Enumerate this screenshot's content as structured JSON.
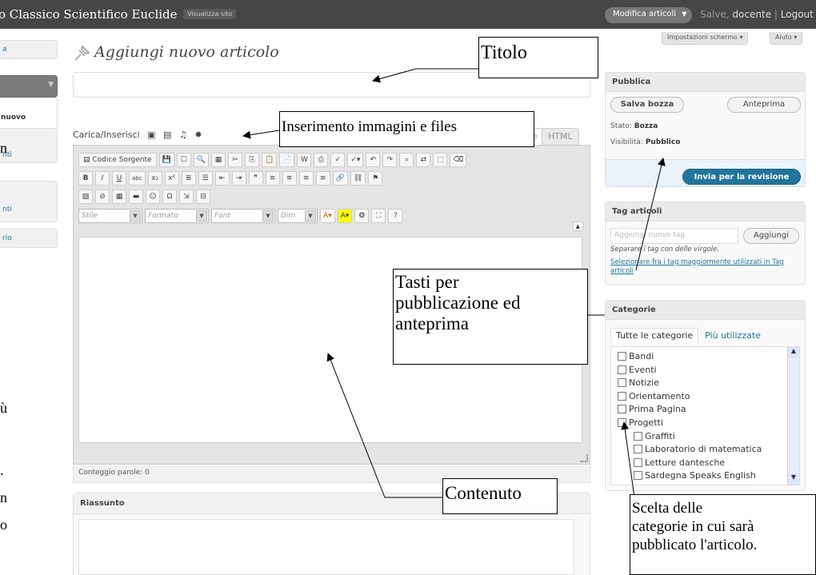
{
  "adminbar": {
    "site_name": "o Classico Scientifico Euclide",
    "visit_site": "Visualizza sito",
    "favorite_action": "Modifica articoli",
    "favorite_arrow": "▼",
    "greeting": "Salve,",
    "username": "docente",
    "separator": "|",
    "logout": "Logout"
  },
  "screen_options": "Impostazioni schermo",
  "help": "Aiuto",
  "sidebar": {
    "items": [
      {
        "label": "a"
      },
      {
        "label": ""
      },
      {
        "label": "nuovo"
      },
      {
        "label": "nti"
      },
      {
        "label": "nti"
      },
      {
        "label": "rio"
      }
    ]
  },
  "page_title": "Aggiungi nuovo articolo",
  "media_label": "Carica/Inserisci",
  "editor": {
    "tab_visual": "Visuale",
    "tab_html": "HTML",
    "source_btn": "Codice Sorgente",
    "style_select": "Stile",
    "format_select": "Formato",
    "font_select": "Font",
    "size_select": "Dim",
    "word_count": "Conteggio parole: 0"
  },
  "excerpt": {
    "title": "Riassunto"
  },
  "publish": {
    "title": "Pubblica",
    "save_draft": "Salva bozza",
    "preview": "Anteprima",
    "status_label": "Stato:",
    "status_value": "Bozza",
    "visibility_label": "Visibilità:",
    "visibility_value": "Pubblico",
    "submit": "Invia per la revisione"
  },
  "tags": {
    "title": "Tag articoli",
    "placeholder": "Aggiungi nuovo tag",
    "add": "Aggiungi",
    "hint": "Separare i tag con delle virgole.",
    "choose_link": "Selezionare fra i tag maggiormente utilizzati in Tag articoli"
  },
  "categories": {
    "title": "Categorie",
    "tab_all": "Tutte le categorie",
    "tab_popular": "Più utilizzate",
    "items": [
      {
        "label": "Bandi",
        "level": 0
      },
      {
        "label": "Eventi",
        "level": 0
      },
      {
        "label": "Notizie",
        "level": 0
      },
      {
        "label": "Orientamento",
        "level": 0
      },
      {
        "label": "Prima Pagina",
        "level": 0
      },
      {
        "label": "Progetti",
        "level": 0
      },
      {
        "label": "Graffiti",
        "level": 1
      },
      {
        "label": "Laboratorio di matematica",
        "level": 1
      },
      {
        "label": "Letture dantesche",
        "level": 1
      },
      {
        "label": "Sardegna Speaks English",
        "level": 1
      }
    ]
  },
  "annotations": {
    "title": "Titolo",
    "media": "Inserimento immagini e files",
    "publish_line1": "Tasti per",
    "publish_line2": "pubblicazione ed",
    "publish_line3": "anteprima",
    "content": "Contenuto",
    "categories_line1": "Scelta delle",
    "categories_line2": "categorie in cui sarà",
    "categories_line3": "pubblicato l'articolo."
  },
  "left_fragments": [
    "n",
    "ù",
    ".",
    "n",
    "o"
  ],
  "colors": {
    "adminbar": "#464646",
    "accent": "#21759b",
    "link": "#21759b"
  }
}
